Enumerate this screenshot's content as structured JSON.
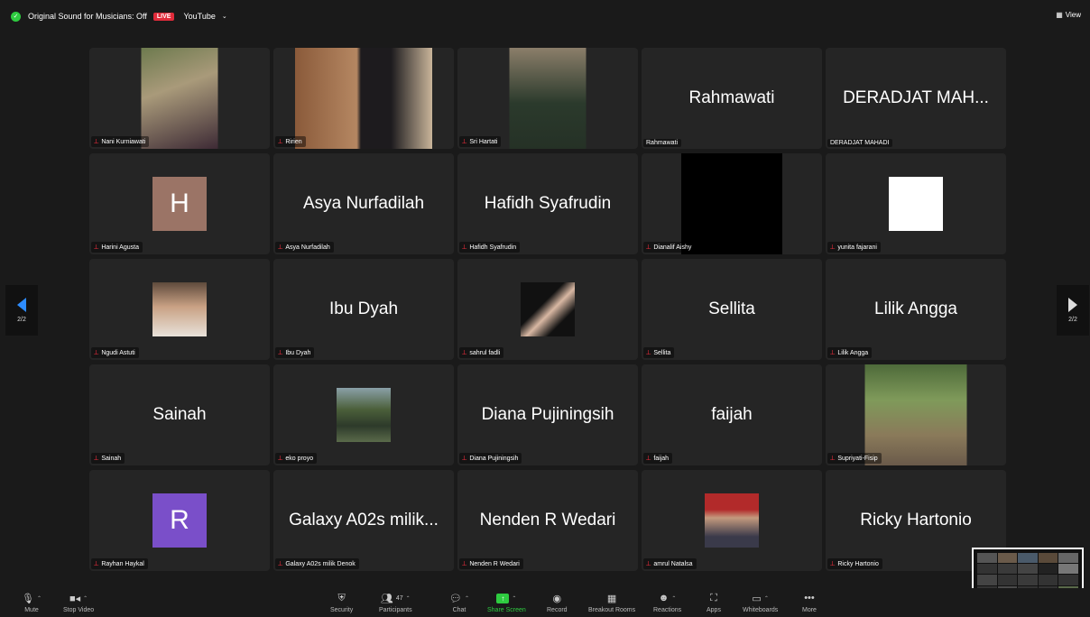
{
  "topbar": {
    "sound_label": "Original Sound for Musicians: Off",
    "live_badge": "LIVE",
    "stream_target": "YouTube",
    "view_label": "View"
  },
  "pager": {
    "left_page": "2/2",
    "right_page": "2/2"
  },
  "tiles": [
    {
      "label": "Nani Kurniawati",
      "display": "",
      "kind": "video"
    },
    {
      "label": "Ririen",
      "display": "",
      "kind": "video"
    },
    {
      "label": "Sri Hartati",
      "display": "",
      "kind": "video"
    },
    {
      "label": "Rahmawati",
      "display": "Rahmawati",
      "kind": "name"
    },
    {
      "label": "DERADJAT MAHADI",
      "display": "DERADJAT MAH...",
      "kind": "name"
    },
    {
      "label": "Harini Agusta",
      "display": "H",
      "kind": "letter"
    },
    {
      "label": "Asya Nurfadilah",
      "display": "Asya Nurfadilah",
      "kind": "name"
    },
    {
      "label": "Hafidh Syafrudin",
      "display": "Hafidh Syafrudin",
      "kind": "name"
    },
    {
      "label": "Dianalif Aishy",
      "display": "",
      "kind": "video"
    },
    {
      "label": "yunita fajarani",
      "display": "",
      "kind": "photo"
    },
    {
      "label": "Ngudi Astuti",
      "display": "",
      "kind": "photo"
    },
    {
      "label": "Ibu Dyah",
      "display": "Ibu Dyah",
      "kind": "name"
    },
    {
      "label": "sahrul fadli",
      "display": "",
      "kind": "photo"
    },
    {
      "label": "Sellita",
      "display": "Sellita",
      "kind": "name"
    },
    {
      "label": "Lilik Angga",
      "display": "Lilik Angga",
      "kind": "name"
    },
    {
      "label": "Sainah",
      "display": "Sainah",
      "kind": "name"
    },
    {
      "label": "eko proyo",
      "display": "",
      "kind": "photo"
    },
    {
      "label": "Diana Pujiningsih",
      "display": "Diana Pujiningsih",
      "kind": "name"
    },
    {
      "label": "faijah",
      "display": "faijah",
      "kind": "name"
    },
    {
      "label": "Supriyati-Fisip",
      "display": "",
      "kind": "video"
    },
    {
      "label": "Rayhan Haykal",
      "display": "R",
      "kind": "letter"
    },
    {
      "label": "Galaxy A02s milik Denok",
      "display": "Galaxy A02s milik...",
      "kind": "name"
    },
    {
      "label": "Nenden R Wedari",
      "display": "Nenden R Wedari",
      "kind": "name"
    },
    {
      "label": "amrul Natalsa",
      "display": "",
      "kind": "photo"
    },
    {
      "label": "Ricky Hartonio",
      "display": "Ricky Hartonio",
      "kind": "name"
    }
  ],
  "toolbar": {
    "mute": "Mute",
    "stop_video": "Stop Video",
    "security": "Security",
    "participants": "Participants",
    "participants_count": "47",
    "chat": "Chat",
    "share_screen": "Share Screen",
    "record": "Record",
    "breakout_rooms": "Breakout Rooms",
    "reactions": "Reactions",
    "apps": "Apps",
    "whiteboards": "Whiteboards",
    "more": "More"
  },
  "colors": {
    "background": "#1a1a1a",
    "tile": "#252525",
    "live": "#e02b3a",
    "accent_green": "#2ecc40",
    "pager_arrow": "#2d8cff",
    "avatar_h": "#9b7466",
    "avatar_r": "#7a4fc9"
  }
}
